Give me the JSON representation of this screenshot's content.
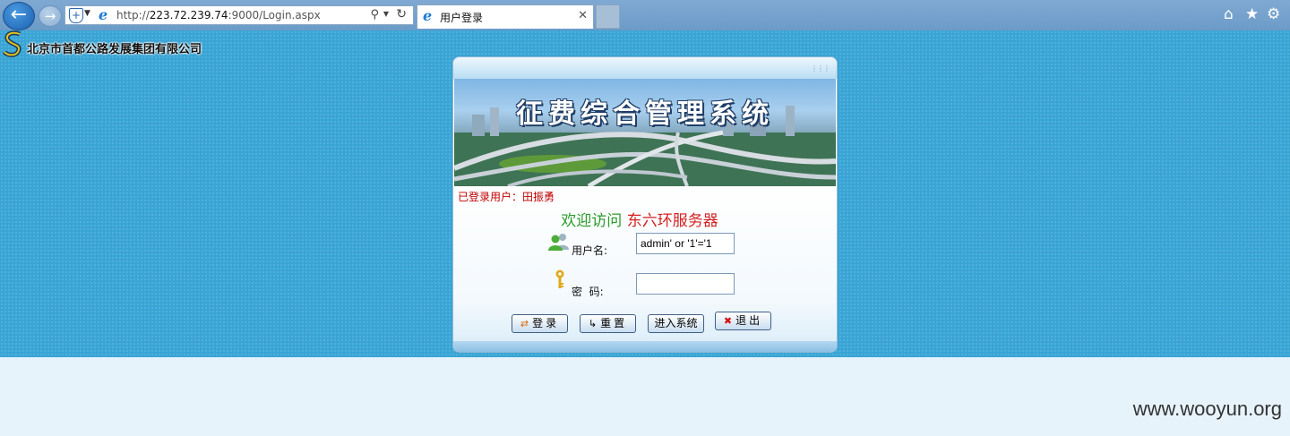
{
  "browser": {
    "url_prefix": "http://",
    "url_host": "223.72.239.74",
    "url_rest": ":9000/Login.aspx",
    "tab_title": "用户登录",
    "icons": [
      "back-arrow",
      "forward-arrow",
      "shield",
      "ie-logo",
      "search",
      "refresh",
      "close",
      "home",
      "star",
      "gear"
    ]
  },
  "page": {
    "company_name": "北京市首都公路发展集团有限公司",
    "banner_title": "征费综合管理系统",
    "logged_in": "已登录用户：田振勇",
    "welcome_prefix": "欢迎访问",
    "welcome_server": "东六环服务器",
    "username_label": "用户名:",
    "password_label": "密  码:",
    "username_value": "admin' or '1'='1",
    "password_value": "",
    "buttons": {
      "login": "登录",
      "reset": "重置",
      "enter": "进入系统",
      "exit": "退出"
    }
  },
  "watermark": "www.wooyun.org",
  "colors": {
    "page_bg": "#3aa4d4",
    "welcome_green": "#2a9b2a",
    "welcome_red": "#d42020",
    "logged_red": "#c00000"
  }
}
